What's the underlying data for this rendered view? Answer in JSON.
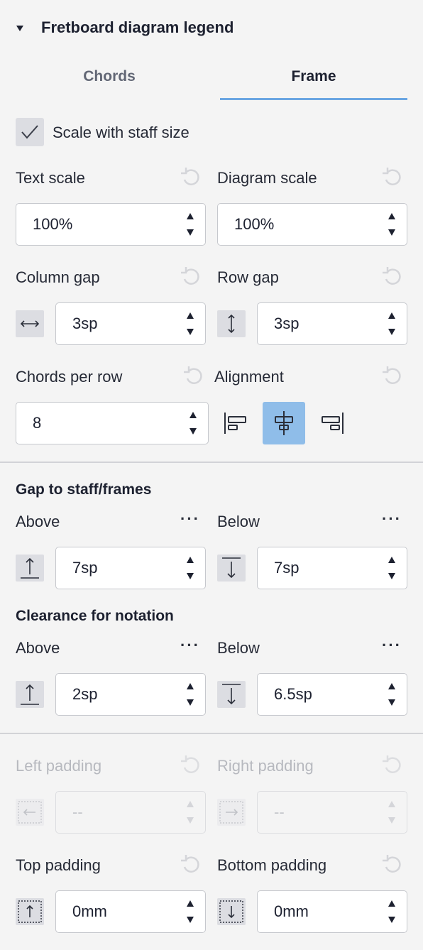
{
  "panel": {
    "title": "Fretboard diagram legend"
  },
  "tabs": [
    {
      "label": "Chords",
      "active": false
    },
    {
      "label": "Frame",
      "active": true
    }
  ],
  "scale_with_staff": {
    "label": "Scale with staff size",
    "checked": true
  },
  "text_scale": {
    "label": "Text scale",
    "value": "100%"
  },
  "diagram_scale": {
    "label": "Diagram scale",
    "value": "100%"
  },
  "column_gap": {
    "label": "Column gap",
    "value": "3sp"
  },
  "row_gap": {
    "label": "Row gap",
    "value": "3sp"
  },
  "chords_per_row": {
    "label": "Chords per row",
    "value": "8"
  },
  "alignment": {
    "label": "Alignment",
    "options": [
      "left",
      "center",
      "right"
    ],
    "selected": "center"
  },
  "gap_to_staff": {
    "title": "Gap to staff/frames",
    "above_label": "Above",
    "above_value": "7sp",
    "below_label": "Below",
    "below_value": "7sp",
    "more": "···"
  },
  "clearance": {
    "title": "Clearance for notation",
    "above_label": "Above",
    "above_value": "2sp",
    "below_label": "Below",
    "below_value": "6.5sp",
    "more": "···"
  },
  "left_padding": {
    "label": "Left padding",
    "value": "--",
    "disabled": true
  },
  "right_padding": {
    "label": "Right padding",
    "value": "--",
    "disabled": true
  },
  "top_padding": {
    "label": "Top padding",
    "value": "0mm"
  },
  "bottom_padding": {
    "label": "Bottom padding",
    "value": "0mm"
  },
  "colors": {
    "accent": "#6ba6e2",
    "active_button": "#8fbde9",
    "background": "#f4f4f4"
  }
}
